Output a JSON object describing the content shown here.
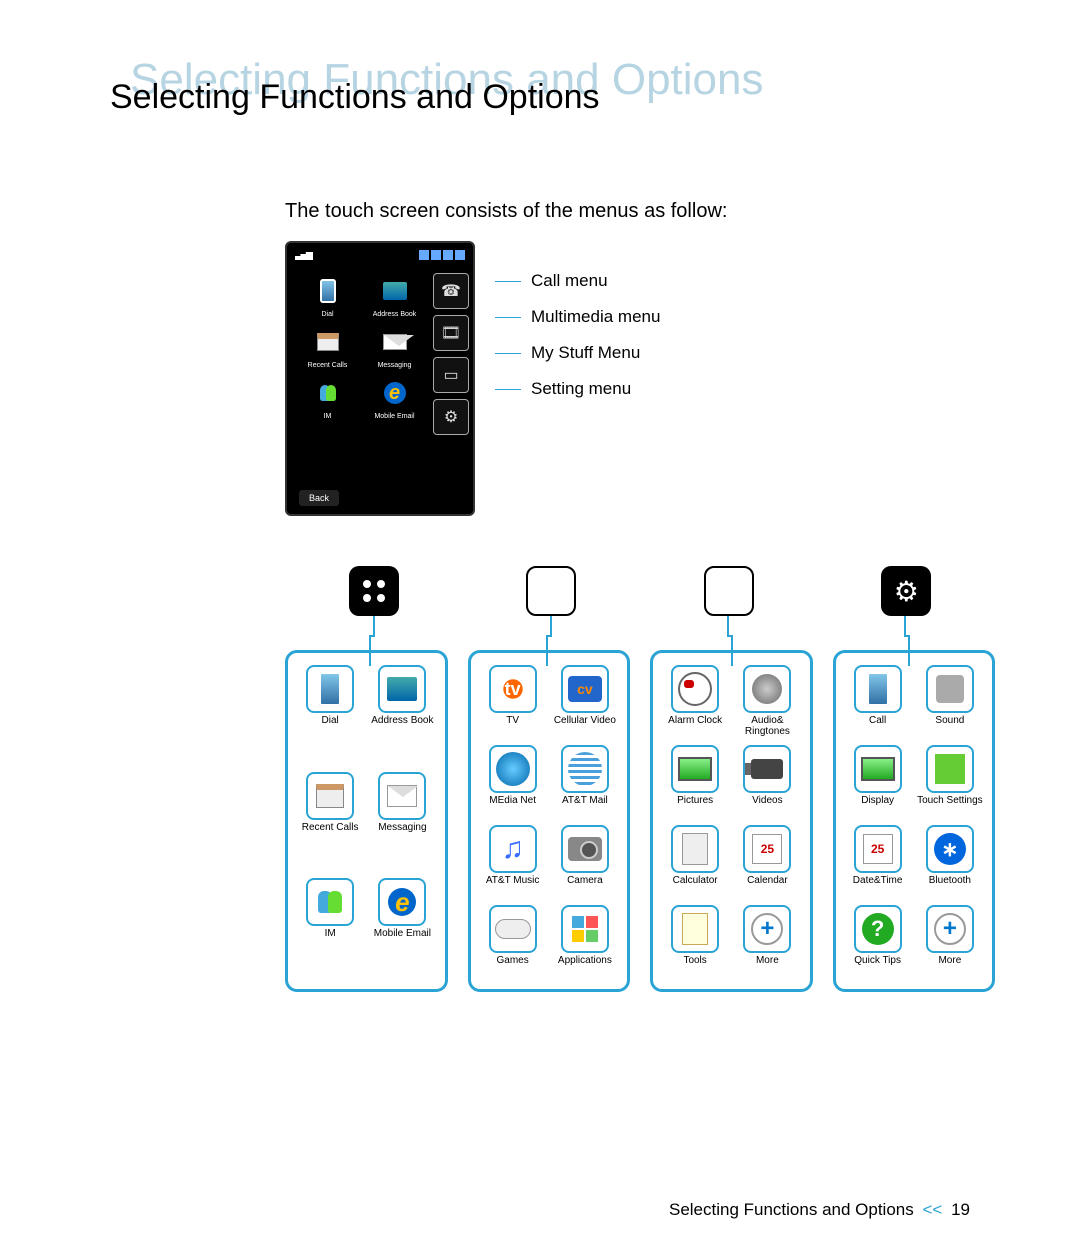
{
  "title_shadow": "Selecting Functions and Options",
  "title": "Selecting Functions and Options",
  "intro": "The touch screen consists of the menus as follow:",
  "phone_screen": {
    "apps": [
      {
        "label": "Dial",
        "icon": "phone-icon"
      },
      {
        "label": "Address Book",
        "icon": "image-icon"
      },
      {
        "label": "Recent Calls",
        "icon": "clip-icon"
      },
      {
        "label": "Messaging",
        "icon": "mail-icon"
      },
      {
        "label": "IM",
        "icon": "im-icon"
      },
      {
        "label": "Mobile Email",
        "icon": "e-icon"
      }
    ],
    "back_label": "Back"
  },
  "callouts": [
    "Call menu",
    "Multimedia menu",
    "My Stuff Menu",
    "Setting menu"
  ],
  "panels": [
    {
      "apps": [
        {
          "label": "Dial"
        },
        {
          "label": "Address Book"
        },
        {
          "label": "Recent Calls"
        },
        {
          "label": "Messaging"
        },
        {
          "label": "IM"
        },
        {
          "label": "Mobile Email"
        }
      ]
    },
    {
      "apps": [
        {
          "label": "TV"
        },
        {
          "label": "Cellular Video"
        },
        {
          "label": "MEdia Net"
        },
        {
          "label": "AT&T Mail"
        },
        {
          "label": "AT&T Music"
        },
        {
          "label": "Camera"
        },
        {
          "label": "Games"
        },
        {
          "label": "Applications"
        }
      ]
    },
    {
      "apps": [
        {
          "label": "Alarm Clock"
        },
        {
          "label": "Audio& Ringtones"
        },
        {
          "label": "Pictures"
        },
        {
          "label": "Videos"
        },
        {
          "label": "Calculator"
        },
        {
          "label": "Calendar"
        },
        {
          "label": "Tools"
        },
        {
          "label": "More"
        }
      ]
    },
    {
      "apps": [
        {
          "label": "Call"
        },
        {
          "label": "Sound"
        },
        {
          "label": "Display"
        },
        {
          "label": "Touch Settings"
        },
        {
          "label": "Date&Time"
        },
        {
          "label": "Bluetooth"
        },
        {
          "label": "Quick Tips"
        },
        {
          "label": "More"
        }
      ]
    }
  ],
  "footer": {
    "text": "Selecting Functions and Options",
    "sep": "<<",
    "page": "19"
  }
}
